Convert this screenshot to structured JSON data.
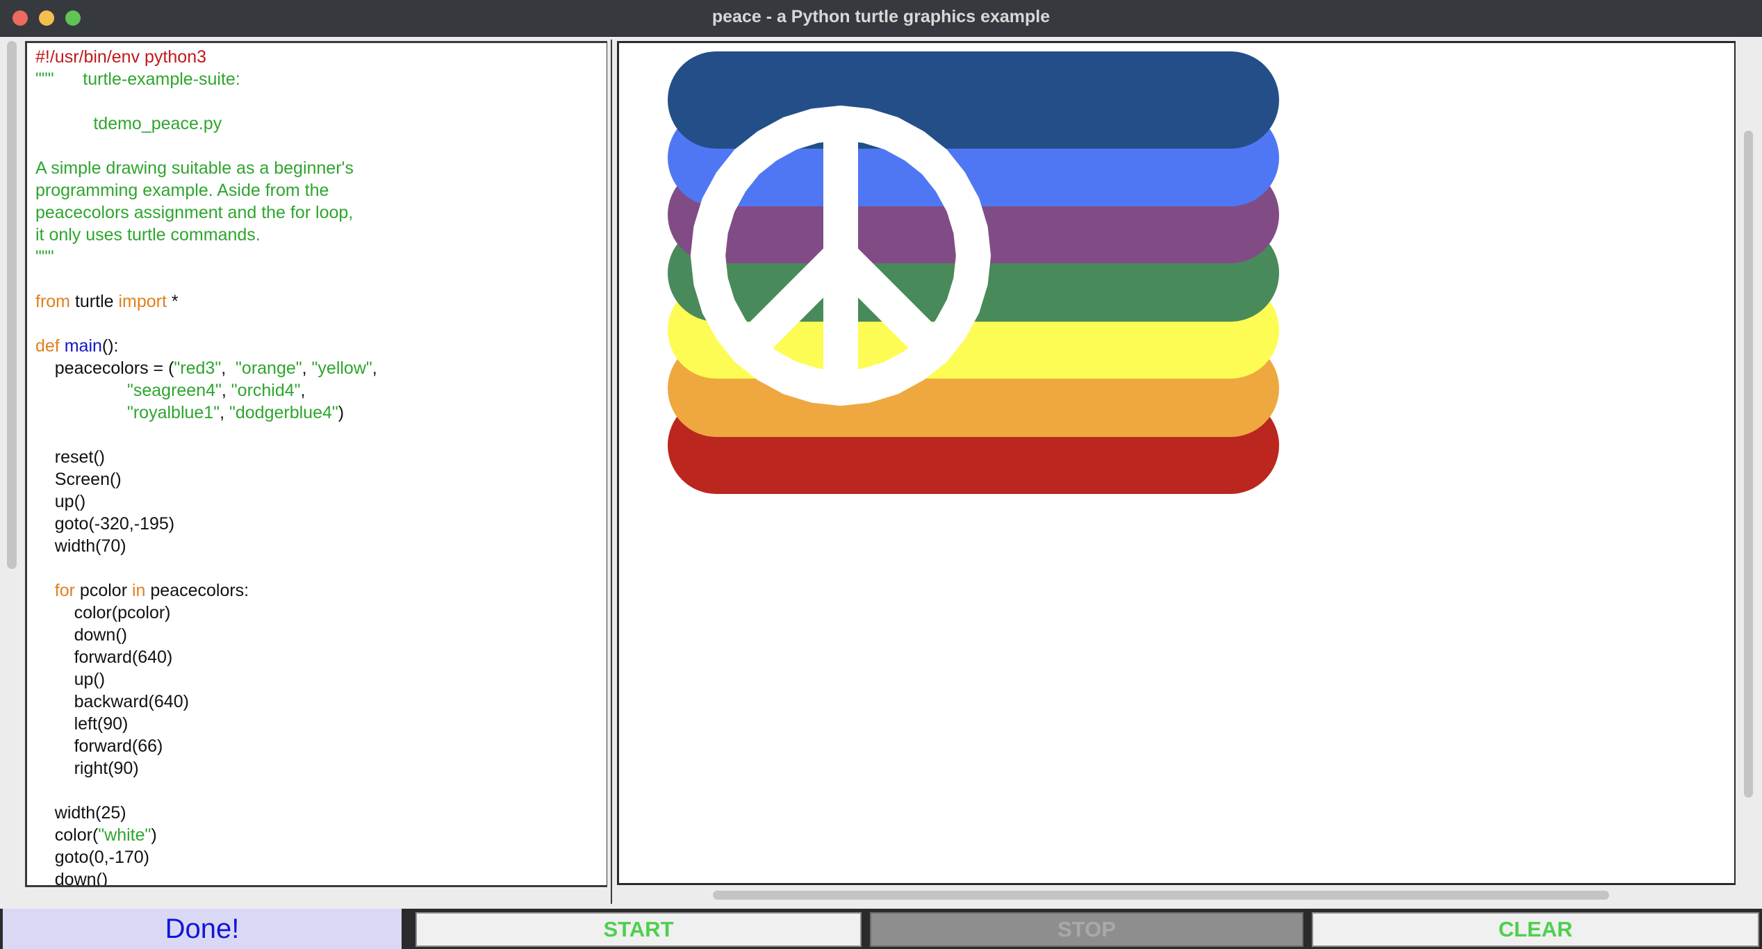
{
  "window": {
    "title": "peace - a Python turtle graphics example"
  },
  "code_lines": [
    "#!/usr/bin/env python3",
    "\"\"\"      turtle-example-suite:",
    "",
    "            tdemo_peace.py",
    "",
    "A simple drawing suitable as a beginner's",
    "programming example. Aside from the",
    "peacecolors assignment and the for loop,",
    "it only uses turtle commands.",
    "\"\"\"",
    "",
    "from turtle import *",
    "",
    "def main():",
    "    peacecolors = (\"red3\",  \"orange\", \"yellow\",",
    "                   \"seagreen4\", \"orchid4\",",
    "                   \"royalblue1\", \"dodgerblue4\")",
    "",
    "    reset()",
    "    Screen()",
    "    up()",
    "    goto(-320,-195)",
    "    width(70)",
    "",
    "    for pcolor in peacecolors:",
    "        color(pcolor)",
    "        down()",
    "        forward(640)",
    "        up()",
    "        backward(640)",
    "        left(90)",
    "        forward(66)",
    "        right(90)",
    "",
    "    width(25)",
    "    color(\"white\")",
    "    goto(0,-170)",
    "    down()"
  ],
  "drawing": {
    "stripe_colors": [
      "#234e88",
      "#5077f3",
      "#814c86",
      "#498a5b",
      "#fdfc54",
      "#eea83f",
      "#bb271e"
    ],
    "symbol_color": "#ffffff"
  },
  "status": {
    "text": "Done!"
  },
  "buttons": {
    "start": "START",
    "stop": "STOP",
    "clear": "CLEAR"
  }
}
